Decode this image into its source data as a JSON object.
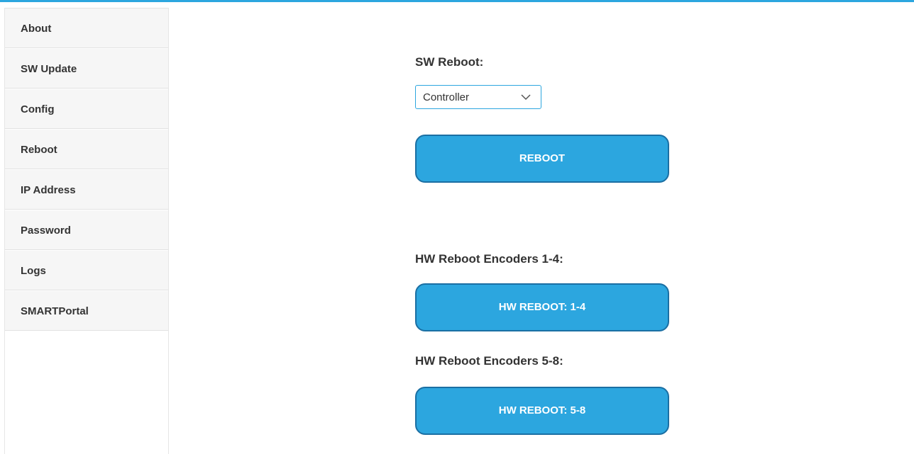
{
  "sidebar": {
    "items": [
      {
        "label": "About"
      },
      {
        "label": "SW Update"
      },
      {
        "label": "Config"
      },
      {
        "label": "Reboot"
      },
      {
        "label": "IP Address"
      },
      {
        "label": "Password"
      },
      {
        "label": "Logs"
      },
      {
        "label": "SMARTPortal"
      }
    ]
  },
  "main": {
    "sw_reboot": {
      "label": "SW Reboot:",
      "selected_option": "Controller",
      "button_label": "REBOOT"
    },
    "hw_reboot_1_4": {
      "label": "HW Reboot Encoders 1-4:",
      "button_label": "HW REBOOT: 1-4"
    },
    "hw_reboot_5_8": {
      "label": "HW Reboot Encoders 5-8:",
      "button_label": "HW REBOOT: 5-8"
    }
  },
  "colors": {
    "accent": "#2ca6df",
    "button_border": "#1b6fa3",
    "nav_background": "#f6f6f6",
    "text": "#333333"
  },
  "icons": {
    "select_arrow": "chevron-down-icon"
  }
}
